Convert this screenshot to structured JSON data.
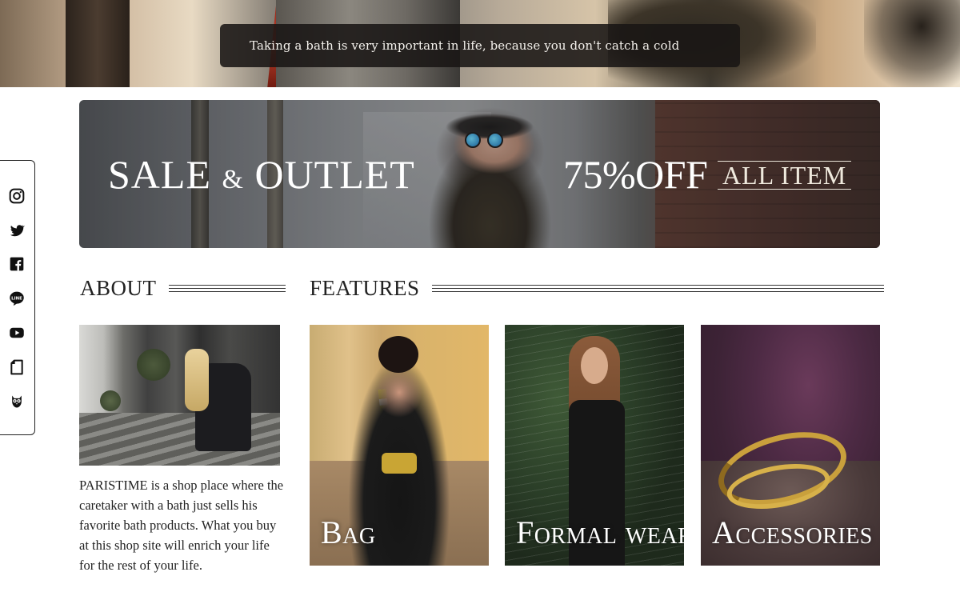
{
  "notice": {
    "text": "Taking a bath is very important in life, because you don't catch a cold"
  },
  "social": [
    {
      "name": "instagram-icon"
    },
    {
      "name": "twitter-icon"
    },
    {
      "name": "facebook-icon"
    },
    {
      "name": "line-icon"
    },
    {
      "name": "youtube-icon"
    },
    {
      "name": "note-icon"
    },
    {
      "name": "owl-icon"
    }
  ],
  "sale": {
    "title_left": "SALE",
    "title_amp": "&",
    "title_right": "OUTLET",
    "discount": "75%OFF",
    "scope": "ALL ITEM"
  },
  "about": {
    "heading": "ABOUT",
    "text": "PARISTIME is a shop place where the caretaker with a bath just sells his favorite bath products. What you buy at this shop site will enrich your life for the rest of your life."
  },
  "features": {
    "heading": "FEATURES",
    "cards": [
      {
        "label": "Bag"
      },
      {
        "label": "Formal wear"
      },
      {
        "label": "Accessories"
      }
    ]
  },
  "colors": {
    "notice_bg": "#19161e",
    "text": "#222222",
    "ring_gold": "#c9a03c"
  }
}
